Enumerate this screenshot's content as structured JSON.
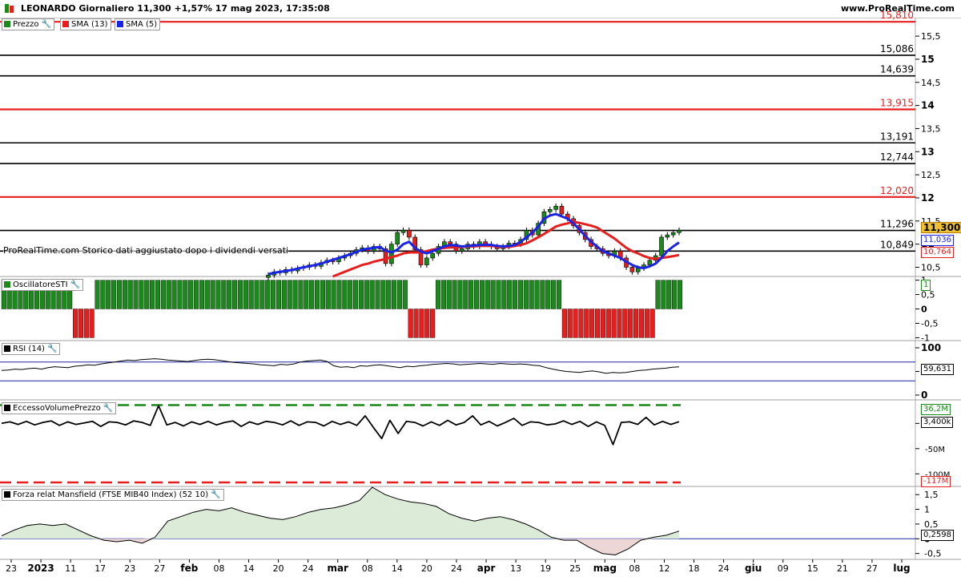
{
  "header": {
    "title": "LEONARDO Giornaliero 11,300 +1,57% 17 mag 2023, 17:35:08",
    "brand": "www.ProRealTime.com"
  },
  "colors": {
    "up": "#1a8a1a",
    "down": "#e61e1e",
    "sma13": "#e61e1e",
    "sma5": "#1a24e6",
    "red_level": "#e61e1e",
    "black_level": "#000000",
    "sti_up": "#1a8a1a",
    "sti_down": "#e61e1e"
  },
  "price_panel": {
    "legend": [
      {
        "label": "Prezzo",
        "color": "#1a8a1a"
      },
      {
        "label": "SMA (13)",
        "color": "#e61e1e"
      },
      {
        "label": "SMA (5)",
        "color": "#1a24e6"
      }
    ],
    "note": "ProRealTime.com  Storico dati aggiustato dopo i dividendi versati",
    "axis_ticks": [
      "15,5",
      "15",
      "14,5",
      "14",
      "13,5",
      "13",
      "12,5",
      "12",
      "11,5",
      "11",
      "10,5"
    ],
    "current_price": "11,300",
    "sma5_value": "11,036",
    "sma13_value": "10,764"
  },
  "chart_data": [
    {
      "type": "candlestick",
      "name": "LEONARDO",
      "x_labels": [
        "23",
        "2023",
        "11",
        "17",
        "23",
        "27",
        "feb",
        "08",
        "14",
        "20",
        "24",
        "mar",
        "08",
        "14",
        "20",
        "24",
        "apr",
        "13",
        "19",
        "25",
        "mag",
        "08",
        "12",
        "18",
        "24",
        "giu",
        "09",
        "15",
        "21",
        "27",
        "lug"
      ],
      "ylim": [
        10.3,
        15.9
      ],
      "levels": [
        {
          "value": 15.81,
          "label": "15,810",
          "color": "red"
        },
        {
          "value": 15.086,
          "label": "15,086",
          "color": "black"
        },
        {
          "value": 14.639,
          "label": "14,639",
          "color": "black"
        },
        {
          "value": 13.915,
          "label": "13,915",
          "color": "red"
        },
        {
          "value": 13.191,
          "label": "13,191",
          "color": "black"
        },
        {
          "value": 12.744,
          "label": "12,744",
          "color": "black"
        },
        {
          "value": 12.02,
          "label": "12,020",
          "color": "red"
        },
        {
          "value": 11.296,
          "label": "11,296",
          "color": "black"
        },
        {
          "value": 10.849,
          "label": "10,849",
          "color": "black"
        }
      ],
      "close": [
        10.33,
        10.4,
        10.38,
        10.45,
        10.42,
        10.48,
        10.5,
        10.55,
        10.52,
        10.6,
        10.65,
        10.62,
        10.7,
        10.75,
        10.8,
        10.88,
        10.92,
        10.85,
        10.95,
        10.9,
        10.58,
        11.0,
        11.25,
        11.3,
        11.15,
        10.88,
        10.55,
        10.7,
        10.8,
        10.95,
        11.05,
        11.0,
        10.85,
        10.9,
        11.0,
        10.95,
        11.05,
        11.0,
        10.95,
        10.9,
        10.95,
        11.02,
        11.0,
        11.1,
        11.3,
        11.2,
        11.45,
        11.7,
        11.75,
        11.82,
        11.65,
        11.55,
        11.4,
        11.25,
        11.1,
        10.95,
        10.9,
        10.8,
        10.75,
        10.85,
        10.7,
        10.5,
        10.4,
        10.48,
        10.55,
        10.65,
        10.75,
        11.15,
        11.2,
        11.25,
        11.3
      ],
      "sma13": [
        null,
        null,
        null,
        null,
        null,
        null,
        null,
        null,
        null,
        null,
        null,
        10.3,
        10.35,
        10.4,
        10.45,
        10.5,
        10.55,
        10.58,
        10.62,
        10.65,
        10.68,
        10.72,
        10.75,
        10.8,
        10.82,
        10.82,
        10.82,
        10.85,
        10.88,
        10.9,
        10.92,
        10.93,
        10.93,
        10.94,
        10.95,
        10.95,
        10.96,
        10.96,
        10.96,
        10.95,
        10.94,
        10.94,
        10.96,
        10.98,
        11.02,
        11.08,
        11.15,
        11.22,
        11.3,
        11.38,
        11.42,
        11.45,
        11.48,
        11.46,
        11.43,
        11.4,
        11.36,
        11.28,
        11.2,
        11.12,
        11.02,
        10.92,
        10.85,
        10.8,
        10.74,
        10.7,
        10.68,
        10.7,
        10.72,
        10.74,
        10.764
      ],
      "sma5": [
        10.35,
        10.38,
        10.4,
        10.42,
        10.44,
        10.47,
        10.5,
        10.52,
        10.55,
        10.58,
        10.62,
        10.66,
        10.7,
        10.74,
        10.78,
        10.83,
        10.88,
        10.9,
        10.92,
        10.94,
        10.86,
        10.82,
        10.88,
        11.0,
        11.05,
        10.92,
        10.84,
        10.8,
        10.85,
        10.9,
        10.95,
        10.98,
        10.97,
        10.95,
        10.96,
        10.97,
        10.98,
        10.99,
        10.98,
        10.96,
        10.95,
        10.96,
        10.98,
        11.05,
        11.15,
        11.25,
        11.38,
        11.55,
        11.62,
        11.65,
        11.6,
        11.55,
        11.45,
        11.32,
        11.18,
        11.05,
        10.95,
        10.85,
        10.8,
        10.75,
        10.7,
        10.62,
        10.55,
        10.5,
        10.48,
        10.52,
        10.58,
        10.7,
        10.85,
        10.95,
        11.036
      ]
    },
    {
      "type": "bar",
      "name": "OscillatoreSTI",
      "values": [
        1,
        1,
        1,
        1,
        1,
        1,
        1,
        1,
        1,
        1,
        1,
        1,
        1,
        -1,
        -1,
        -1,
        -1,
        1,
        1,
        1,
        1,
        1,
        1,
        1,
        1,
        1,
        1,
        1,
        1,
        1,
        1,
        1,
        1,
        1,
        1,
        1,
        1,
        1,
        1,
        1,
        1,
        1,
        1,
        1,
        1,
        1,
        1,
        1,
        1,
        1,
        1,
        1,
        1,
        1,
        1,
        1,
        1,
        1,
        1,
        1,
        1,
        1,
        1,
        1,
        1,
        1,
        1,
        1,
        1,
        1,
        1,
        1,
        1,
        1,
        -1,
        -1,
        -1,
        -1,
        -1,
        1,
        1,
        1,
        1,
        1,
        1,
        1,
        1,
        1,
        1,
        1,
        1,
        1,
        1,
        1,
        1,
        1,
        1,
        1,
        1,
        1,
        1,
        1,
        -1,
        -1,
        -1,
        -1,
        -1,
        -1,
        -1,
        -1,
        -1,
        -1,
        -1,
        -1,
        -1,
        -1,
        -1,
        -1,
        -1,
        1,
        1,
        1,
        1,
        1
      ],
      "axis_ticks": [
        "1",
        "0,5",
        "0",
        "-0,5",
        "-1"
      ],
      "last_label": "1",
      "ylim": [
        -1.1,
        1.1
      ]
    },
    {
      "type": "line",
      "name": "RSI (14)",
      "axis_ticks": [
        "100",
        "50",
        "0"
      ],
      "last_label": "59,631",
      "ylim": [
        0,
        100
      ],
      "bands": [
        70,
        30
      ],
      "values": [
        52,
        53,
        55,
        54,
        56,
        57,
        55,
        58,
        60,
        59,
        58,
        61,
        62,
        64,
        63,
        66,
        68,
        70,
        72,
        74,
        73,
        75,
        76,
        77,
        76,
        74,
        73,
        72,
        71,
        73,
        75,
        76,
        75,
        73,
        71,
        69,
        68,
        67,
        66,
        64,
        63,
        62,
        65,
        64,
        66,
        70,
        72,
        73,
        74,
        71,
        62,
        59,
        60,
        58,
        62,
        61,
        63,
        64,
        62,
        60,
        58,
        61,
        60,
        62,
        63,
        65,
        66,
        67,
        66,
        64,
        65,
        66,
        67,
        66,
        65,
        67,
        66,
        65,
        66,
        65,
        63,
        62,
        58,
        55,
        52,
        50,
        49,
        48,
        50,
        51,
        49,
        46,
        48,
        47,
        48,
        50,
        52,
        53,
        55,
        56,
        57,
        59,
        59.631
      ]
    },
    {
      "type": "line",
      "name": "EccessoVolumePrezzo",
      "axis_ticks": [
        "36,2M",
        "3,400k",
        "0",
        "-50M",
        "-100M",
        "-117M"
      ],
      "upper_band": 36.2,
      "lower_band": -117,
      "last_label": "3,400k",
      "ylim": [
        -125,
        45
      ],
      "values": [
        0,
        3,
        -2,
        4,
        -3,
        2,
        5,
        -4,
        3,
        -2,
        1,
        4,
        -6,
        3,
        2,
        -3,
        5,
        2,
        -4,
        35,
        -3,
        2,
        -5,
        3,
        -2,
        4,
        -3,
        2,
        5,
        -6,
        3,
        -2,
        4,
        2,
        -3,
        5,
        -4,
        3,
        2,
        -5,
        4,
        -2,
        3,
        -4,
        15,
        -8,
        -30,
        6,
        -20,
        4,
        2,
        -5,
        3,
        -4,
        6,
        -3,
        2,
        15,
        -3,
        4,
        -5,
        2,
        10,
        -4,
        3,
        2,
        -3,
        -1,
        5,
        -2,
        4,
        -6,
        3,
        -4,
        -42,
        2,
        3,
        -2,
        12,
        -3,
        4,
        -2,
        3.4
      ]
    },
    {
      "type": "area",
      "name": "Forza relat Mansfield (FTSE MIB40 Index) (52 10)",
      "axis_ticks": [
        "1,5",
        "1",
        "0,5",
        "0",
        "-0,5"
      ],
      "last_label": "0,2598",
      "ylim": [
        -0.7,
        1.75
      ],
      "values": [
        0.1,
        0.3,
        0.45,
        0.5,
        0.45,
        0.5,
        0.3,
        0.1,
        -0.05,
        -0.1,
        -0.05,
        -0.15,
        0.05,
        0.6,
        0.75,
        0.9,
        1.0,
        0.95,
        1.05,
        0.9,
        0.8,
        0.7,
        0.65,
        0.75,
        0.9,
        1.0,
        1.05,
        1.15,
        1.3,
        1.75,
        1.5,
        1.35,
        1.25,
        1.2,
        1.1,
        0.85,
        0.7,
        0.6,
        0.7,
        0.75,
        0.65,
        0.5,
        0.3,
        0.05,
        -0.05,
        -0.05,
        -0.3,
        -0.5,
        -0.55,
        -0.35,
        -0.05,
        0.05,
        0.12,
        0.2598
      ]
    }
  ]
}
